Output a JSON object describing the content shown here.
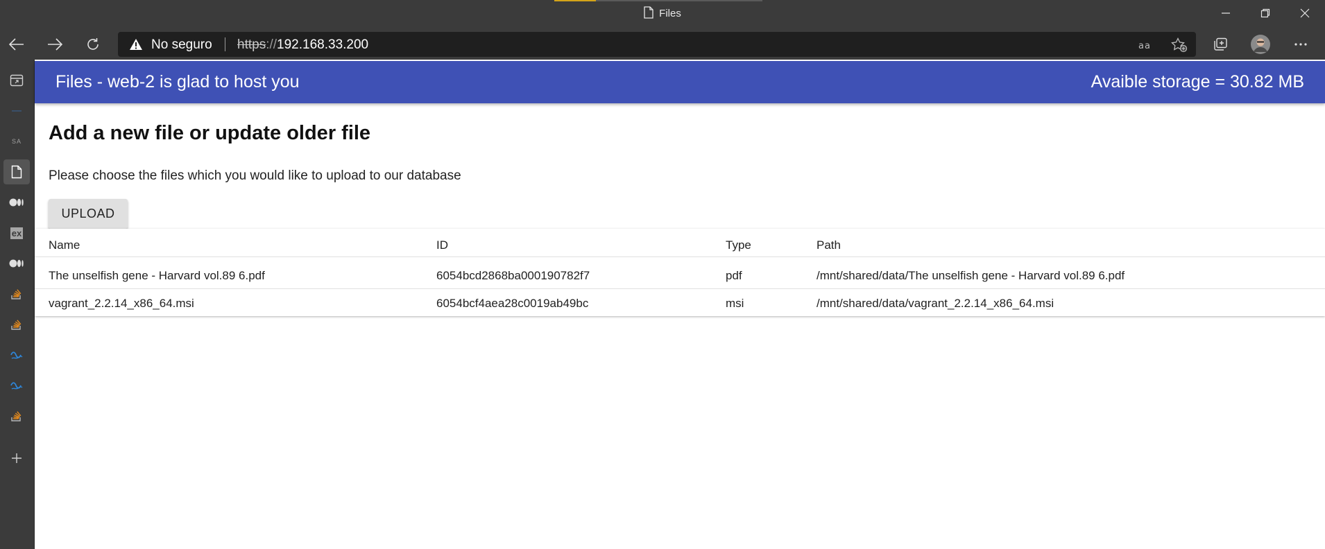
{
  "window": {
    "title": "Files"
  },
  "browser": {
    "security_label": "No seguro",
    "url_scheme": "https",
    "url_slashes": "://",
    "url_host": "192.168.33.200"
  },
  "sidebar": {
    "sa_label": "SA",
    "ex_label": "ex"
  },
  "header": {
    "title": "Files - web-2 is glad to host you",
    "storage": "Avaible storage = 30.82 MB"
  },
  "main": {
    "heading": "Add a new file or update older file",
    "description": "Please choose the files which you would like to upload to our database",
    "upload_label": "UPLOAD"
  },
  "table": {
    "columns": [
      "Name",
      "ID",
      "Type",
      "Path"
    ],
    "rows": [
      {
        "name": "The unselfish gene - Harvard vol.89 6.pdf",
        "id": "6054bcd2868ba000190782f7",
        "type": "pdf",
        "path": "/mnt/shared/data/The unselfish gene - Harvard vol.89 6.pdf"
      },
      {
        "name": "vagrant_2.2.14_x86_64.msi",
        "id": "6054bcf4aea28c0019ab49bc",
        "type": "msi",
        "path": "/mnt/shared/data/vagrant_2.2.14_x86_64.msi"
      }
    ]
  },
  "colors": {
    "header_bg": "#3f51b5",
    "browser_chrome": "#3b3b3b"
  }
}
